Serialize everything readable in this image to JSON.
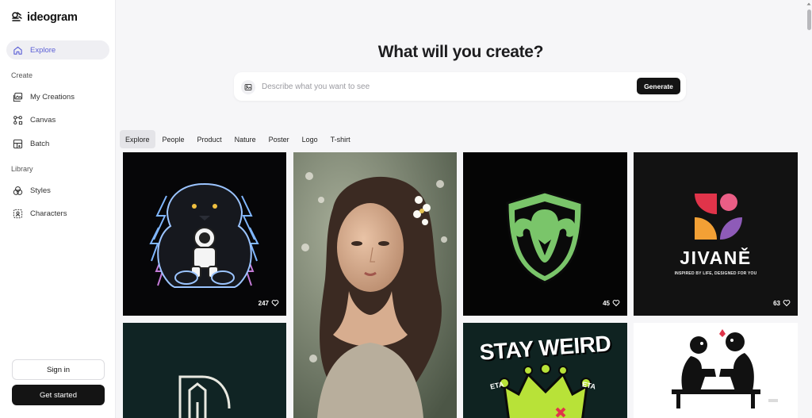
{
  "brand": {
    "name": "ideogram"
  },
  "sidebar": {
    "explore": "Explore",
    "create_label": "Create",
    "create_items": [
      "My Creations",
      "Canvas",
      "Batch"
    ],
    "library_label": "Library",
    "library_items": [
      "Styles",
      "Characters"
    ],
    "sign_in": "Sign in",
    "get_started": "Get started"
  },
  "main": {
    "headline": "What will you create?",
    "prompt_placeholder": "Describe what you want to see",
    "generate_label": "Generate",
    "tabs": [
      "Explore",
      "People",
      "Product",
      "Nature",
      "Poster",
      "Logo",
      "T-shirt"
    ],
    "active_tab": "Explore"
  },
  "gallery": {
    "items": [
      {
        "subject": "panther with astronaut illustration",
        "likes": "247"
      },
      {
        "subject": "portrait of woman with flower in hair",
        "likes": ""
      },
      {
        "subject": "green ram head shield logo",
        "likes": "45"
      },
      {
        "subject": "JIVANĚ brand logo",
        "likes": "63",
        "title": "JIVANĚ",
        "tagline": "INSPIRED BY LIFE, DESIGNED FOR YOU"
      },
      {
        "subject": "letter D house logo",
        "likes": ""
      },
      {
        "subject": "STAY WEIRD crown t-shirt",
        "likes": "",
        "title": "STAY WEIRD",
        "side_text": "ETA"
      },
      {
        "subject": "two skeleton figures on bench",
        "likes": ""
      }
    ]
  },
  "colors": {
    "accent": "#5b5fd6",
    "sidebar_active_bg": "#efeff3",
    "button_dark": "#141414",
    "page_bg": "#f6f6f8"
  }
}
